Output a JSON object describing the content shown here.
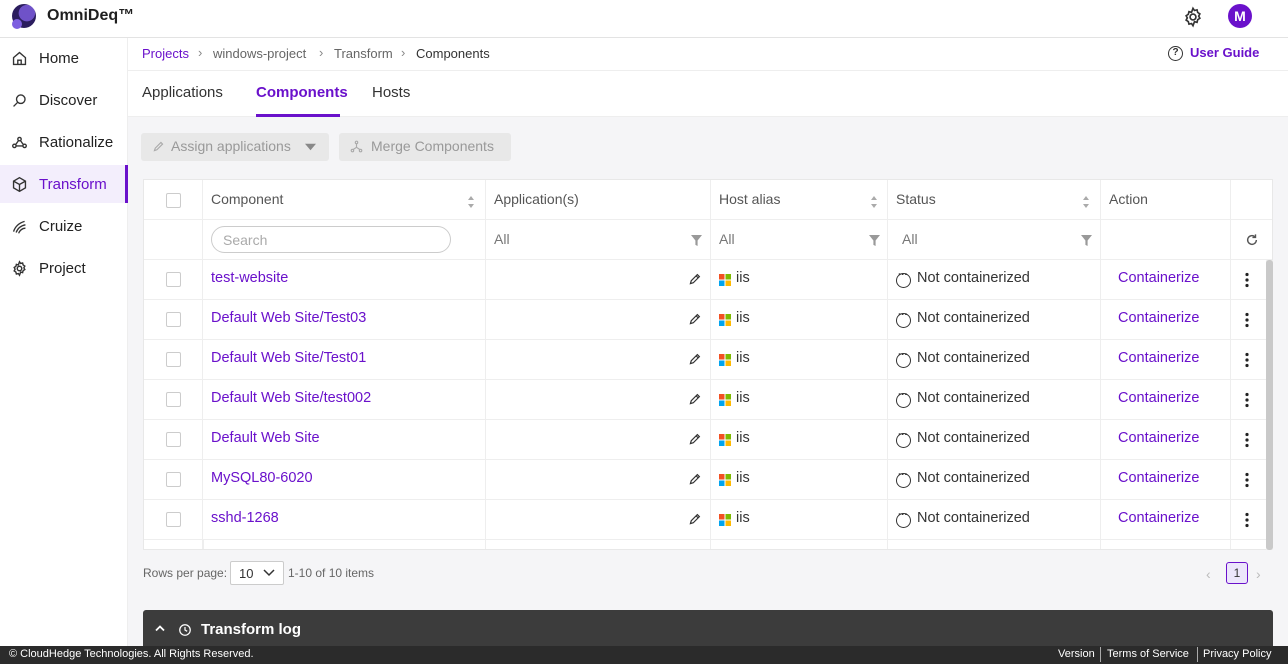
{
  "app": {
    "title": "OmniDeq™",
    "avatar_initial": "M"
  },
  "sidebar": {
    "items": [
      {
        "label": "Home",
        "icon": "home-icon"
      },
      {
        "label": "Discover",
        "icon": "discover-icon"
      },
      {
        "label": "Rationalize",
        "icon": "rationalize-icon"
      },
      {
        "label": "Transform",
        "icon": "transform-icon",
        "active": true
      },
      {
        "label": "Cruize",
        "icon": "cruize-icon"
      },
      {
        "label": "Project",
        "icon": "gear-icon"
      }
    ]
  },
  "breadcrumb": [
    "Projects",
    "windows-project",
    "Transform",
    "Components"
  ],
  "user_guide": "User Guide",
  "tabs": [
    "Applications",
    "Components",
    "Hosts"
  ],
  "active_tab": "Components",
  "toolbar": {
    "assign_label": "Assign applications",
    "merge_label": "Merge Components"
  },
  "table": {
    "headers": [
      "Component",
      "Application(s)",
      "Host alias",
      "Status",
      "Action"
    ],
    "search_placeholder": "Search",
    "filter_application": "All",
    "filter_host": "All",
    "filter_status": "All",
    "rows": [
      {
        "component": "test-website",
        "host": "iis",
        "status": "Not containerized",
        "action": "Containerize"
      },
      {
        "component": "Default Web Site/Test03",
        "host": "iis",
        "status": "Not containerized",
        "action": "Containerize"
      },
      {
        "component": "Default Web Site/Test01",
        "host": "iis",
        "status": "Not containerized",
        "action": "Containerize"
      },
      {
        "component": "Default Web Site/test002",
        "host": "iis",
        "status": "Not containerized",
        "action": "Containerize"
      },
      {
        "component": "Default Web Site",
        "host": "iis",
        "status": "Not containerized",
        "action": "Containerize"
      },
      {
        "component": "MySQL80-6020",
        "host": "iis",
        "status": "Not containerized",
        "action": "Containerize"
      },
      {
        "component": "sshd-1268",
        "host": "iis",
        "status": "Not containerized",
        "action": "Containerize"
      }
    ]
  },
  "pagination": {
    "rows_label": "Rows per page:",
    "rows_value": "10",
    "range": "1-10 of 10 items",
    "page": "1"
  },
  "log": {
    "title": "Transform log"
  },
  "footer": {
    "copyright": "© CloudHedge Technologies. All Rights Reserved.",
    "links": [
      "Version",
      "Terms of Service",
      "Privacy Policy"
    ]
  },
  "colors": {
    "accent": "#6a11cb"
  }
}
